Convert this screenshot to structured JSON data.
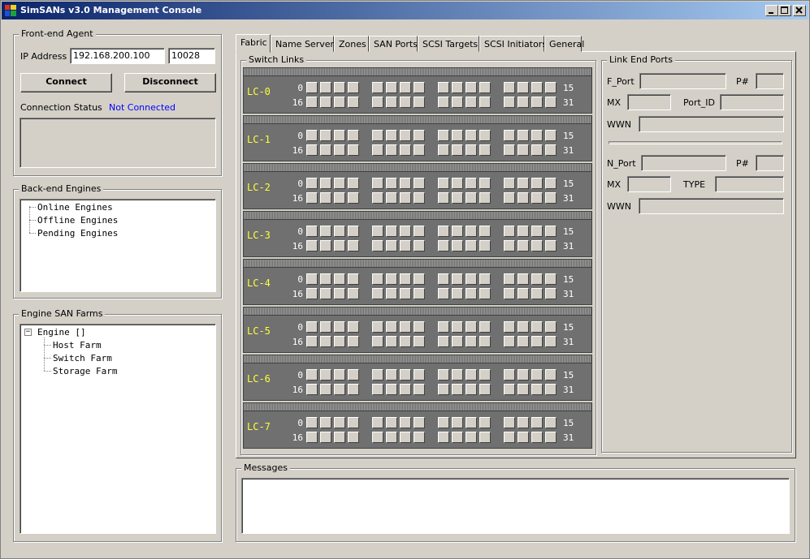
{
  "window": {
    "title": "SimSANs v3.0 Management Console"
  },
  "frontend": {
    "legend": "Front-end Agent",
    "ip_label": "IP Address",
    "ip_value": "192.168.200.100",
    "port_value": "10028",
    "connect_label": "Connect",
    "disconnect_label": "Disconnect",
    "status_label": "Connection Status",
    "status_value": "Not Connected",
    "status_color": "#0000ff"
  },
  "backend": {
    "legend": "Back-end Engines",
    "items": [
      "Online Engines",
      "Offline Engines",
      "Pending Engines"
    ]
  },
  "farms": {
    "legend": "Engine SAN Farms",
    "root": "Engine []",
    "expander": "−",
    "children": [
      "Host Farm",
      "Switch Farm",
      "Storage Farm"
    ]
  },
  "tabs": [
    "Fabric",
    "Name Servers",
    "Zones",
    "SAN Ports",
    "SCSI Targets",
    "SCSI Initiators",
    "General"
  ],
  "active_tab": "Fabric",
  "switch_links": {
    "legend": "Switch Links",
    "cards": [
      "LC-0",
      "LC-1",
      "LC-2",
      "LC-3",
      "LC-4",
      "LC-5",
      "LC-6",
      "LC-7"
    ],
    "row1_start": "0",
    "row1_end": "15",
    "row2_start": "16",
    "row2_end": "31",
    "label_color": "#ffff3c"
  },
  "link_end": {
    "legend": "Link End Ports",
    "f_port": "F_Port",
    "p1": "P#",
    "mx1": "MX",
    "port_id": "Port_ID",
    "wwn1": "WWN",
    "n_port": "N_Port",
    "p2": "P#",
    "mx2": "MX",
    "type": "TYPE",
    "wwn2": "WWN"
  },
  "messages": {
    "legend": "Messages"
  }
}
